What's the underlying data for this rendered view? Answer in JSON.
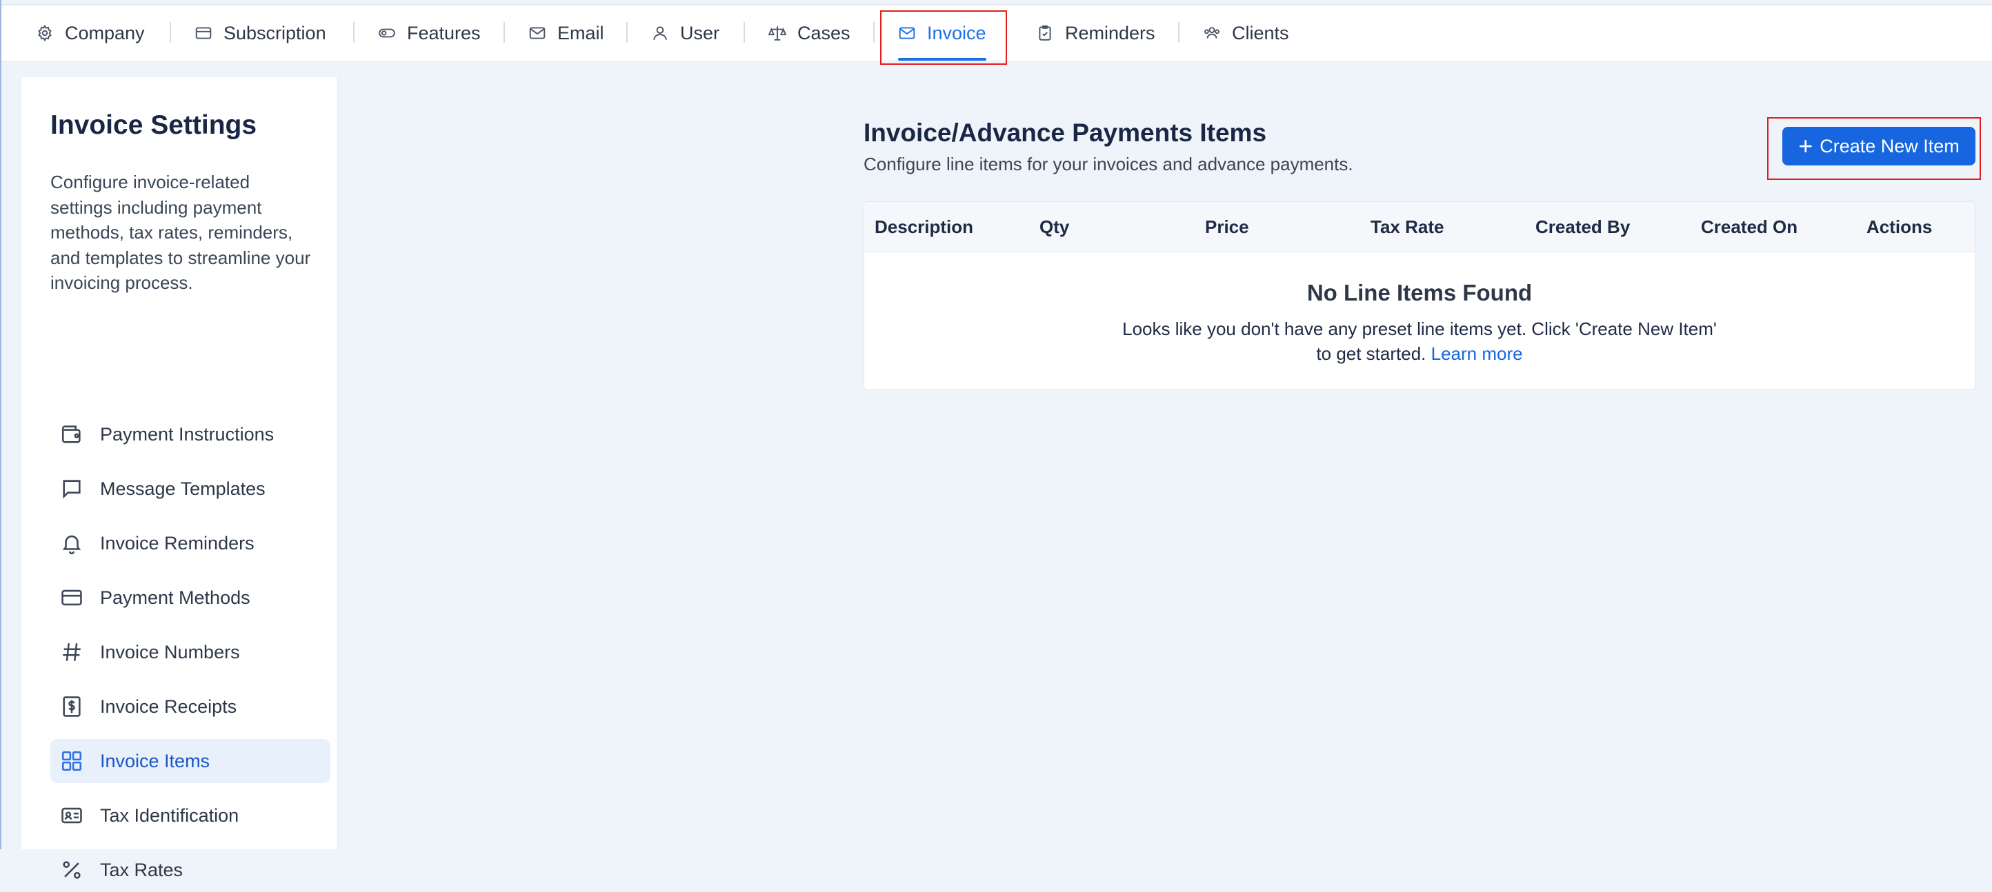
{
  "nav": {
    "tabs": [
      {
        "label": "Company",
        "icon": "gear-icon"
      },
      {
        "label": "Subscription",
        "icon": "card-icon"
      },
      {
        "label": "Features",
        "icon": "toggle-icon"
      },
      {
        "label": "Email",
        "icon": "mail-icon"
      },
      {
        "label": "User",
        "icon": "user-icon"
      },
      {
        "label": "Cases",
        "icon": "scale-icon"
      },
      {
        "label": "Invoice",
        "icon": "mail-icon"
      },
      {
        "label": "Reminders",
        "icon": "clipboard-check-icon"
      },
      {
        "label": "Clients",
        "icon": "users-icon"
      }
    ],
    "active_tab": "Invoice",
    "accent_color": "#1d6fe8"
  },
  "sidebar": {
    "title": "Invoice Settings",
    "description": "Configure invoice-related settings including payment methods, tax rates, reminders, and templates to streamline your invoicing process.",
    "items": [
      {
        "label": "Payment Instructions",
        "icon": "wallet-icon"
      },
      {
        "label": "Message Templates",
        "icon": "message-icon"
      },
      {
        "label": "Invoice Reminders",
        "icon": "bell-icon"
      },
      {
        "label": "Payment Methods",
        "icon": "credit-card-icon"
      },
      {
        "label": "Invoice Numbers",
        "icon": "hash-icon"
      },
      {
        "label": "Invoice Receipts",
        "icon": "receipt-dollar-icon"
      },
      {
        "label": "Invoice Items",
        "icon": "grid-icon"
      },
      {
        "label": "Tax Identification",
        "icon": "id-card-icon"
      },
      {
        "label": "Tax Rates",
        "icon": "percent-icon"
      }
    ],
    "active_item": "Invoice Items"
  },
  "main": {
    "title": "Invoice/Advance Payments Items",
    "subtitle": "Configure line items for your invoices and advance payments.",
    "create_button": "Create New Item",
    "table": {
      "columns": [
        "Description",
        "Qty",
        "Price",
        "Tax Rate",
        "Created By",
        "Created On",
        "Actions"
      ]
    },
    "empty_state": {
      "title": "No Line Items Found",
      "text_line1": "Looks like you don't have any preset line items yet. Click 'Create New Item'",
      "text_line2": "to get started.",
      "link": "Learn more"
    }
  }
}
